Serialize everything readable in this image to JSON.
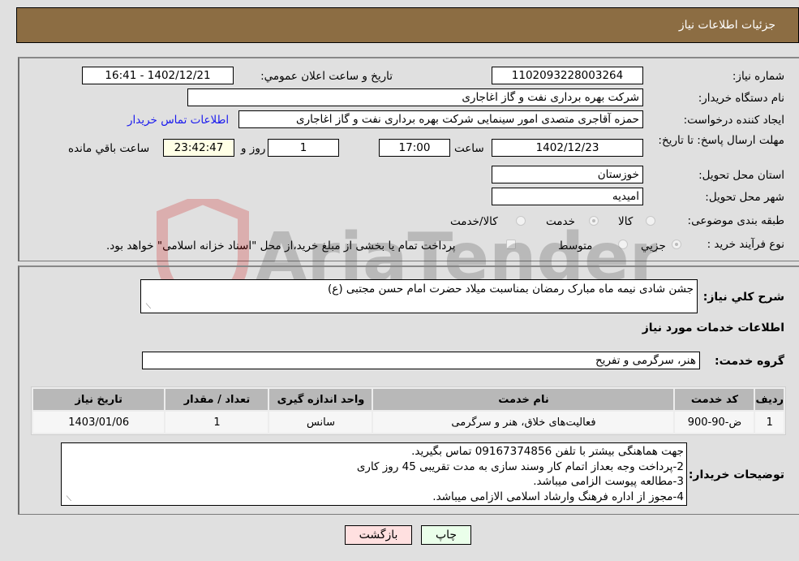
{
  "header": {
    "title": "جزئیات اطلاعات نیاز"
  },
  "form": {
    "need_number_label": "شماره نیاز:",
    "need_number": "1102093228003264",
    "announce_label": "تاریخ و ساعت اعلان عمومي:",
    "announce_value": "1402/12/21 - 16:41",
    "buyer_org_label": "نام دستگاه خریدار:",
    "buyer_org": "شرکت بهره برداری نفت و گاز اغاجاری",
    "requester_label": "ایجاد کننده درخواست:",
    "requester": "حمزه آقاجری متصدی امور سینمایی شرکت بهره برداری نفت و گاز اغاجاری",
    "contact_link": "اطلاعات تماس خریدار",
    "deadline_label": "مهلت ارسال پاسخ: تا تاریخ:",
    "deadline_date": "1402/12/23",
    "time_label": "ساعت",
    "deadline_time": "17:00",
    "days_value": "1",
    "days_label": "روز و",
    "remaining_time": "23:42:47",
    "remaining_label": "ساعت باقي مانده",
    "province_label": "استان محل تحویل:",
    "province": "خوزستان",
    "city_label": "شهر محل تحویل:",
    "city": "امیدیه",
    "category_label": "طبقه بندی موضوعی:",
    "category_options": [
      "کالا",
      "خدمت",
      "کالا/خدمت"
    ],
    "category_selected": "خدمت",
    "process_label": "نوع فرآیند خرید :",
    "process_options": [
      "جزيي",
      "متوسط"
    ],
    "payment_note": "پرداخت تمام یا بخشی از مبلغ خرید،از محل \"اسناد خزانه اسلامی\" خواهد بود."
  },
  "details": {
    "summary_label": "شرح کلي نياز:",
    "summary": "جشن شادی نیمه ماه مبارک رمضان بمناسبت میلاد حضرت امام حسن مجتبی (ع)",
    "services_title": "اطلاعات خدمات مورد نياز",
    "service_group_label": "گروه خدمت:",
    "service_group": "هنر، سرگرمی و تفریح",
    "table": {
      "headers": [
        "ردیف",
        "کد خدمت",
        "نام خدمت",
        "واحد اندازه گیری",
        "تعداد / مقدار",
        "تاریخ نیاز"
      ],
      "rows": [
        [
          "1",
          "ض-90-900",
          "فعالیت‌های خلاق، هنر و سرگرمی",
          "سانس",
          "1",
          "1403/01/06"
        ]
      ]
    },
    "buyer_notes_label": "توضیحات خریدار:",
    "buyer_notes": [
      "جهت هماهنگی بیشتر با تلفن 09167374856 تماس بگیرید.",
      "2-پرداخت وجه بعداز اتمام کار وسند سازی به مدت تقریبی 45 روز کاری",
      "3-مطالعه پیوست الزامی میباشد.",
      "4-مجوز از اداره فرهنگ وارشاد اسلامی الازامی میباشد."
    ]
  },
  "buttons": {
    "print": "چاپ",
    "back": "بازگشت"
  },
  "watermark": {
    "text": "AriaTender.neT"
  },
  "colors": {
    "header_bg": "#8c6d43",
    "timer_bg": "#ffffe6",
    "print_bg": "#eaffea",
    "back_bg": "#ffe0e0",
    "link": "#1a1aee"
  }
}
